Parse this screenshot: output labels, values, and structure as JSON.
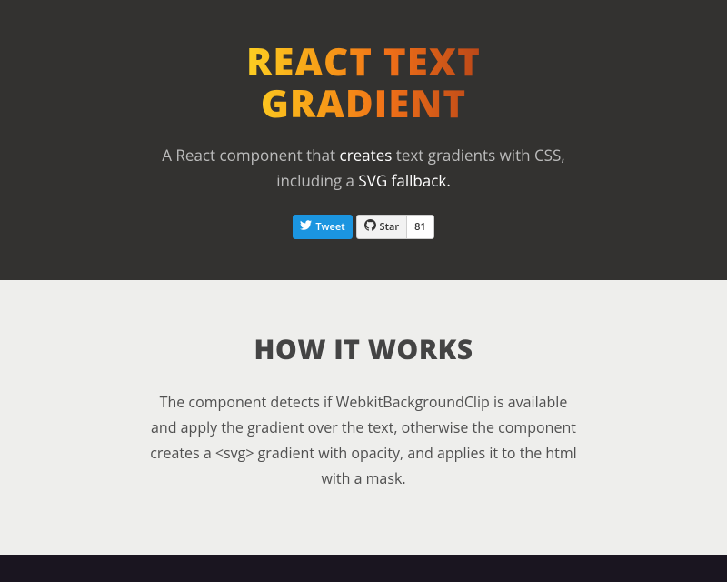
{
  "hero": {
    "title_line1": "REACT TEXT",
    "title_line2": "GRADIENT",
    "subtitle_part1": "A React component that ",
    "subtitle_highlight1": "creates",
    "subtitle_part2": " text gradients with CSS, including a ",
    "subtitle_highlight2": "SVG fallback.",
    "tweet_label": "Tweet",
    "star_label": "Star",
    "star_count": "81"
  },
  "how": {
    "title": "HOW IT WORKS",
    "text": "The component detects if WebkitBackgroundClip is available and apply the gradient over the text, otherwise the component creates a <svg> gradient with opacity, and applies it to the html with a mask."
  }
}
